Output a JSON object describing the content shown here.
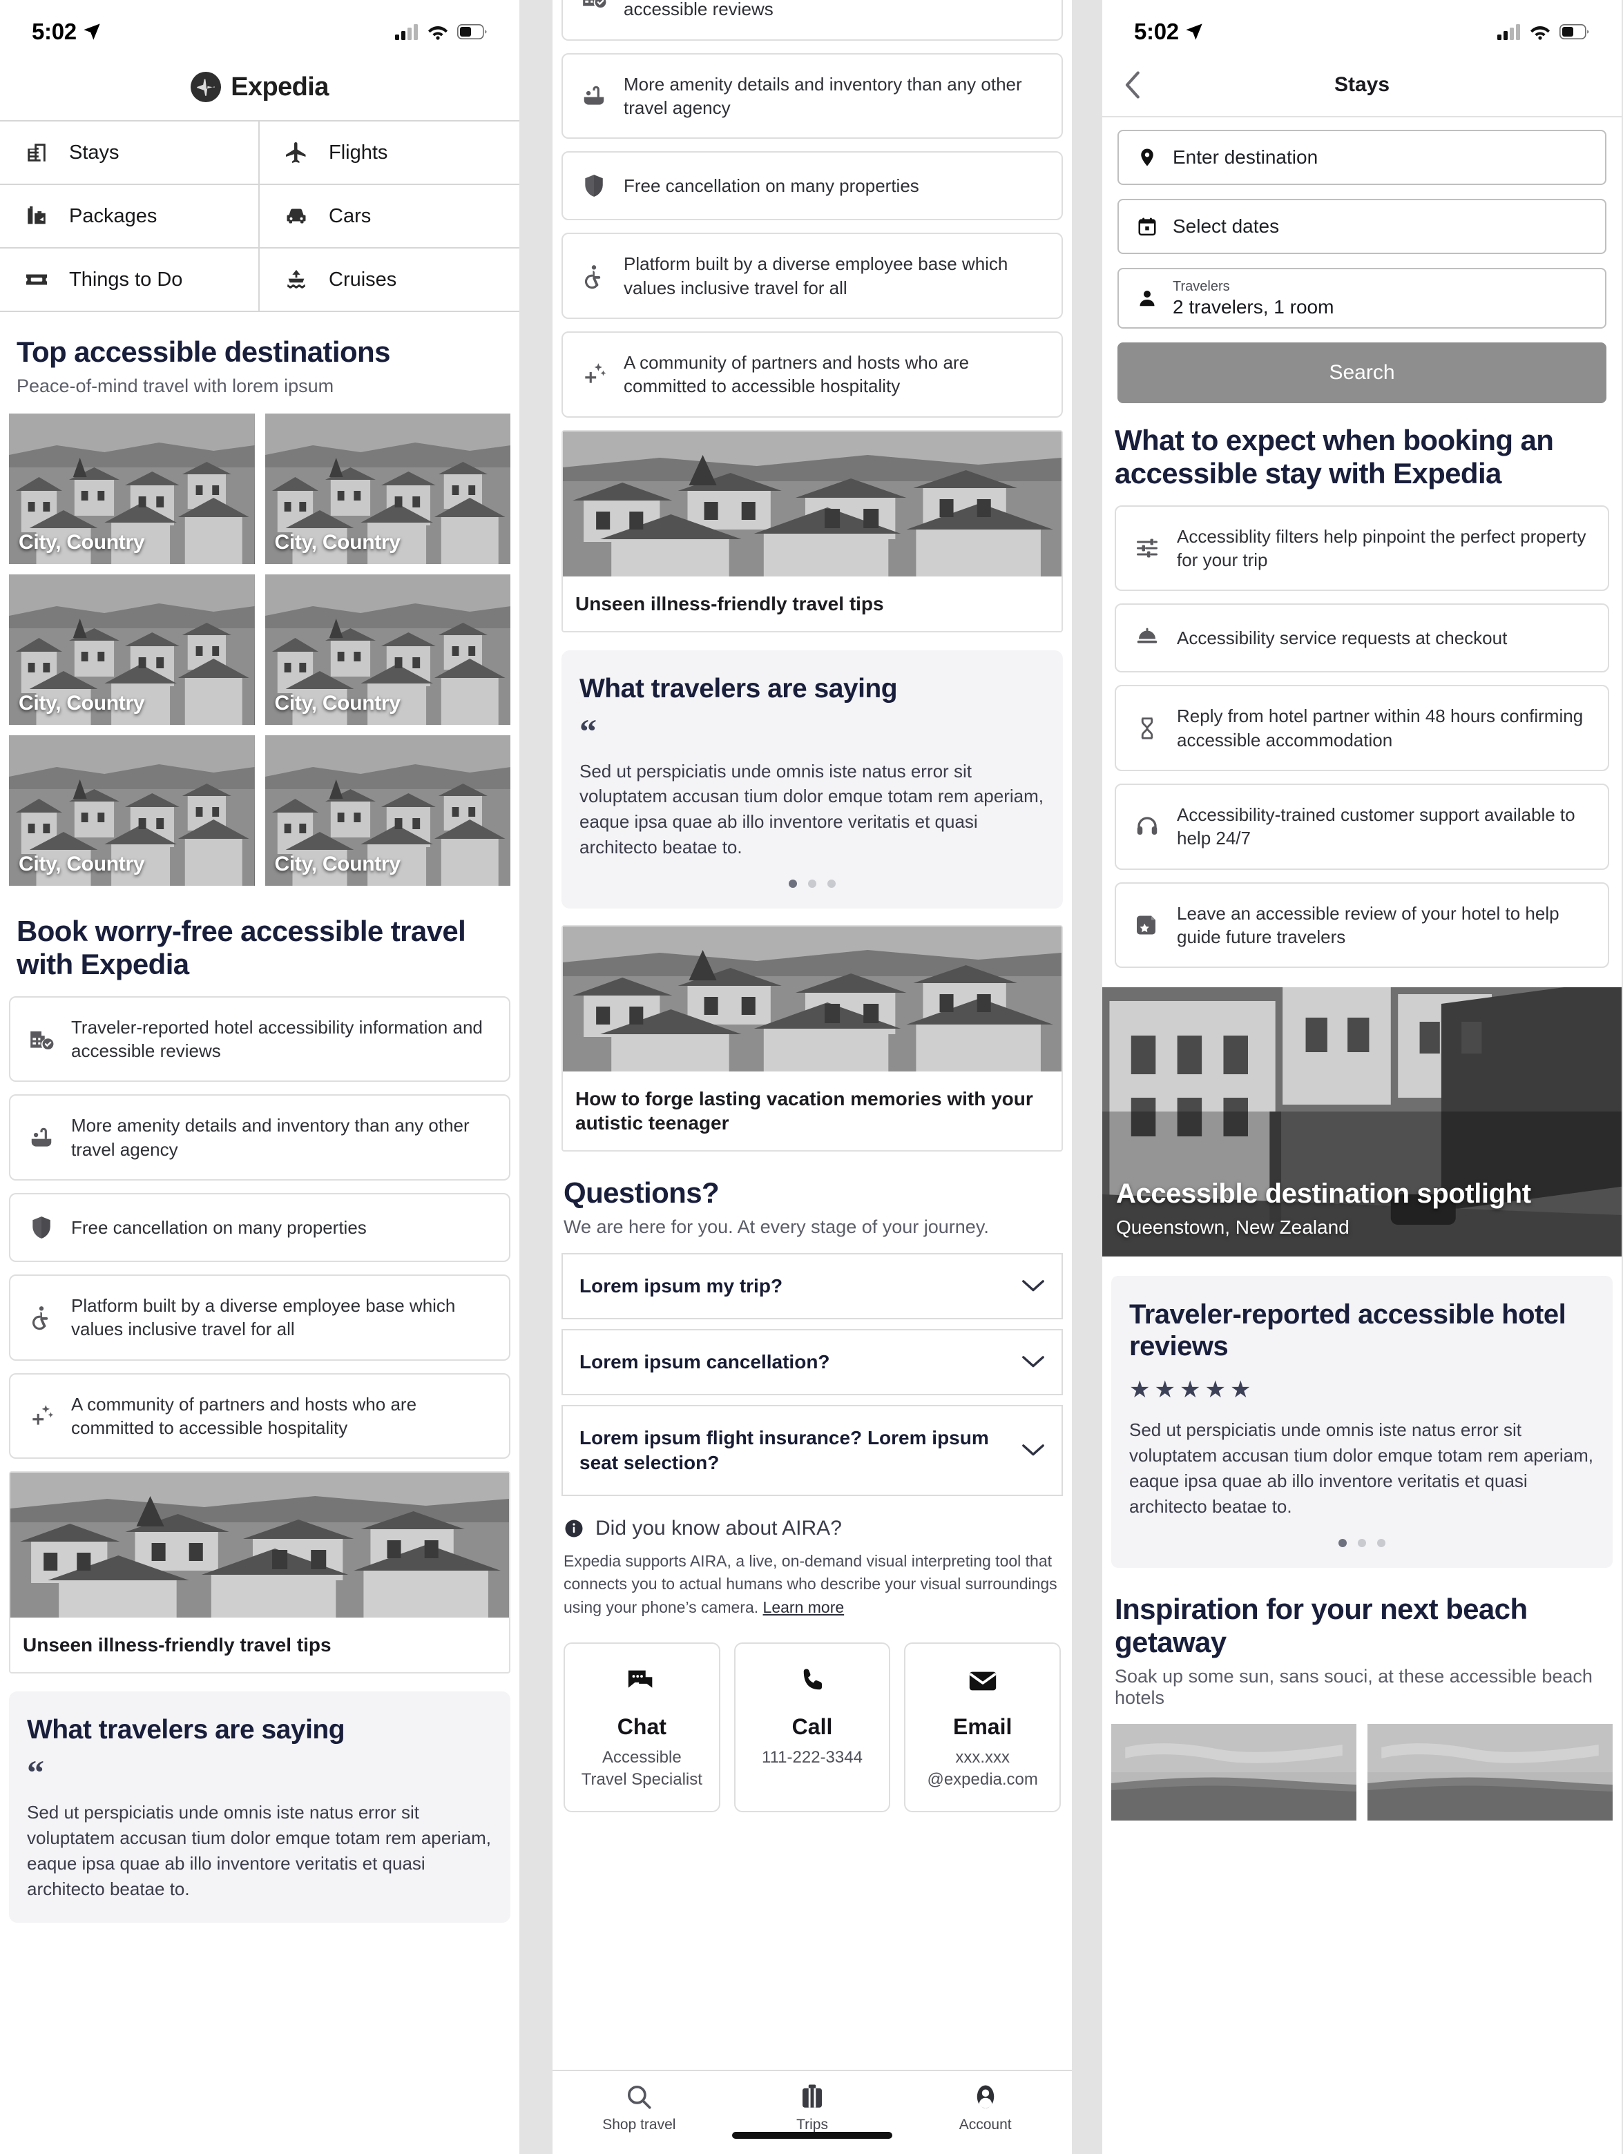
{
  "status_bar": {
    "time": "5:02",
    "location_icon": "location-arrow-icon",
    "signal_icon": "cellular-signal-icon",
    "wifi_icon": "wifi-icon",
    "battery_icon": "battery-icon"
  },
  "panel1": {
    "brand": {
      "logo_icon": "expedia-plane-logo-icon",
      "name": "Expedia"
    },
    "nav": [
      {
        "icon": "building-icon",
        "label": "Stays"
      },
      {
        "icon": "airplane-icon",
        "label": "Flights"
      },
      {
        "icon": "luggage-icon",
        "label": "Packages"
      },
      {
        "icon": "car-icon",
        "label": "Cars"
      },
      {
        "icon": "ticket-icon",
        "label": "Things to Do"
      },
      {
        "icon": "cruise-ship-icon",
        "label": "Cruises"
      }
    ],
    "destinations": {
      "title": "Top accessible destinations",
      "subtitle": "Peace-of-mind travel with lorem ipsum",
      "tiles": [
        {
          "label": "City, Country"
        },
        {
          "label": "City, Country"
        },
        {
          "label": "City, Country"
        },
        {
          "label": "City, Country"
        },
        {
          "label": "City, Country"
        },
        {
          "label": "City, Country"
        }
      ]
    },
    "worryfree": {
      "title": "Book worry-free accessible travel with Expedia",
      "features": [
        {
          "icon": "hotel-check-icon",
          "text": "Traveler-reported hotel accessibility information and accessible reviews"
        },
        {
          "icon": "accessible-bath-icon",
          "text": "More amenity details and inventory than any other travel agency"
        },
        {
          "icon": "shield-icon",
          "text": "Free cancellation on many properties"
        },
        {
          "icon": "wheelchair-icon",
          "text": "Platform built by a diverse employee base which values inclusive travel for all"
        },
        {
          "icon": "sparkle-icon",
          "text": "A community of partners and hosts who are committed to accessible hospitality"
        }
      ]
    },
    "article": {
      "image_icon": "town-rooftops-photo",
      "caption": "Unseen illness-friendly travel tips"
    },
    "quote": {
      "title": "What travelers are saying",
      "quote_mark": "“",
      "body": "Sed ut perspiciatis unde omnis iste natus error sit voluptatem accusan tium dolor emque totam rem aperiam, eaque ipsa quae ab illo inventore veritatis et quasi architecto beatae to."
    }
  },
  "panel2": {
    "features": [
      {
        "icon": "hotel-check-icon",
        "text": "Traveler-reported hotel accessibility information and accessible reviews"
      },
      {
        "icon": "accessible-bath-icon",
        "text": "More amenity details and inventory than any other travel agency"
      },
      {
        "icon": "shield-icon",
        "text": "Free cancellation on many properties"
      },
      {
        "icon": "wheelchair-icon",
        "text": "Platform built by a diverse employee base which values inclusive travel for all"
      },
      {
        "icon": "sparkle-icon",
        "text": "A community of partners and hosts who are committed to accessible hospitality"
      }
    ],
    "article1": {
      "caption": "Unseen illness-friendly travel tips"
    },
    "quote": {
      "title": "What travelers are saying",
      "quote_mark": "“",
      "body": "Sed ut perspiciatis unde omnis iste natus error sit voluptatem accusan tium dolor emque totam rem aperiam, eaque ipsa quae ab illo inventore veritatis et quasi architecto beatae to."
    },
    "article2": {
      "caption": "How to forge lasting vacation memories with your autistic teenager"
    },
    "questions": {
      "title": "Questions?",
      "subtitle": "We are here for you. At every stage of your journey.",
      "items": [
        {
          "label": "Lorem ipsum my trip?",
          "chevron": "chevron-down-icon"
        },
        {
          "label": "Lorem ipsum cancellation?",
          "chevron": "chevron-down-icon"
        },
        {
          "label": "Lorem ipsum flight insurance? Lorem ipsum seat selection?",
          "chevron": "chevron-down-icon"
        }
      ]
    },
    "aira": {
      "icon": "info-icon",
      "title": "Did you know about AIRA?",
      "body": "Expedia supports AIRA, a live, on-demand visual interpreting tool that connects you to actual humans who describe your visual surroundings using your phone’s camera.",
      "link": "Learn more"
    },
    "contacts": [
      {
        "icon": "chat-bubble-icon",
        "title": "Chat",
        "sub": "Accessible\nTravel Specialist"
      },
      {
        "icon": "phone-icon",
        "title": "Call",
        "sub": "111-222-3344"
      },
      {
        "icon": "envelope-icon",
        "title": "Email",
        "sub": "xxx.xxx\n@expedia.com"
      }
    ],
    "tabbar": [
      {
        "icon": "search-icon",
        "label": "Shop travel"
      },
      {
        "icon": "suitcase-icon",
        "label": "Trips"
      },
      {
        "icon": "account-icon",
        "label": "Account"
      }
    ]
  },
  "panel3": {
    "header": {
      "back_icon": "chevron-left-icon",
      "title": "Stays"
    },
    "search_form": {
      "destination": {
        "icon": "map-pin-icon",
        "placeholder": "Enter destination"
      },
      "dates": {
        "icon": "calendar-icon",
        "placeholder": "Select dates"
      },
      "travelers": {
        "icon": "person-icon",
        "label": "Travelers",
        "value": "2 travelers, 1 room"
      },
      "search_button": "Search"
    },
    "expect": {
      "title": "What to expect when booking an accessible stay with Expedia",
      "items": [
        {
          "icon": "filter-sliders-icon",
          "text": "Accessiblity filters help pinpoint the perfect property for your trip"
        },
        {
          "icon": "room-service-bell-icon",
          "text": "Accessibility service requests at checkout"
        },
        {
          "icon": "hourglass-icon",
          "text": "Reply from hotel partner within 48 hours confirming accessible accommodation"
        },
        {
          "icon": "headset-icon",
          "text": "Accessibility-trained customer support available to help 24/7"
        },
        {
          "icon": "review-badge-icon",
          "text": "Leave an accessible review of your hotel to help guide future travelers"
        }
      ]
    },
    "spotlight": {
      "title": "Accessible destination spotlight",
      "subtitle": "Queenstown, New Zealand"
    },
    "reviews": {
      "title": "Traveler-reported accessible hotel reviews",
      "rating": 5,
      "star_glyph": "★",
      "body": "Sed ut perspiciatis unde omnis iste natus error sit voluptatem accusan tium dolor emque totam rem aperiam, eaque ipsa quae ab illo inventore veritatis et quasi architecto beatae to."
    },
    "beach": {
      "title": "Inspiration for your next beach getaway",
      "subtitle": "Soak up some sun, sans souci, at these accessible beach hotels"
    }
  },
  "colors": {
    "accent": "#191e3b",
    "muted": "#5b5d68",
    "border": "#dedede",
    "button_gray": "#8e8e8e",
    "panel_bg": "#f4f4f6"
  }
}
